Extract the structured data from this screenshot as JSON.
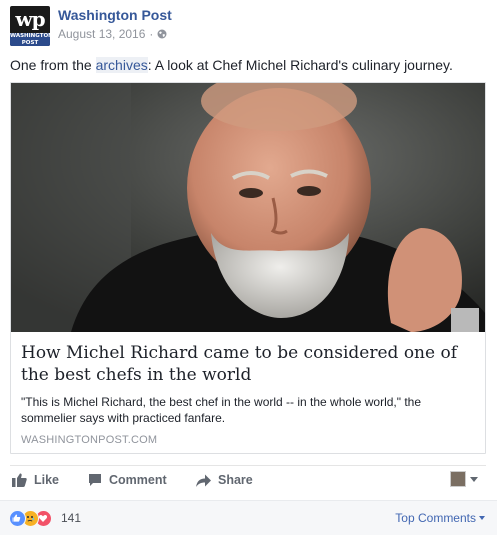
{
  "header": {
    "logo_text": "wp",
    "logo_subtext": "WASHINGTON POST",
    "page_name": "Washington Post",
    "date": "August 13, 2016",
    "separator": "·",
    "privacy_icon": "globe-icon"
  },
  "post": {
    "text_before": "One from the ",
    "link_text": "archives",
    "text_after": ": A look at Chef Michel Richard's culinary journey."
  },
  "card": {
    "title": "How Michel Richard came to be considered one of the best chefs in the world",
    "description": "\"This is Michel Richard, the best chef in the world -- in the whole world,\" the sommelier says with practiced fanfare.",
    "domain": "WASHINGTONPOST.COM"
  },
  "actions": {
    "like": "Like",
    "comment": "Comment",
    "share": "Share"
  },
  "reactions": {
    "icons": [
      "like-icon",
      "sad-icon",
      "love-icon"
    ],
    "count": "141",
    "sort_label": "Top Comments"
  },
  "colors": {
    "link_blue": "#365899",
    "meta_gray": "#90949c",
    "facebook_blue": "#4267b2"
  }
}
